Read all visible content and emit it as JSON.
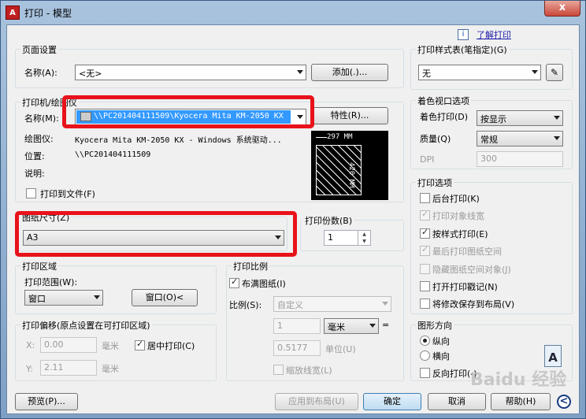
{
  "window": {
    "title": "打印 - 模型",
    "app_icon": "A",
    "close": "x"
  },
  "help": {
    "link": "了解打印"
  },
  "page_setup": {
    "group": "页面设置",
    "name_label": "名称(A):",
    "name_value": "<无>",
    "add_button": "添加(.)..."
  },
  "printer": {
    "group": "打印机/绘图仪",
    "name_label": "名称(M):",
    "name_value": "\\\\PC201404111509\\Kyocera Mita KM-2050 KX",
    "properties_button": "特性(R)...",
    "plotter_label": "绘图仪:",
    "plotter_value": "Kyocera Mita KM-2050 KX - Windows 系统驱动...",
    "location_label": "位置:",
    "location_value": "\\\\PC201404111509",
    "description_label": "说明:",
    "print_to_file": "打印到文件(F)",
    "preview_width": "297 MM",
    "preview_height": "420 MM"
  },
  "paper_size": {
    "group": "图纸尺寸(Z)",
    "value": "A3"
  },
  "copies": {
    "label": "打印份数(B)",
    "value": "1"
  },
  "plot_area": {
    "group": "打印区域",
    "range_label": "打印范围(W):",
    "range_value": "窗口",
    "window_button": "窗口(O)<"
  },
  "plot_offset": {
    "group": "打印偏移(原点设置在可打印区域)",
    "x_label": "X:",
    "x_value": "0.00",
    "x_unit": "毫米",
    "y_label": "Y:",
    "y_value": "2.11",
    "y_unit": "毫米",
    "center": "居中打印(C)"
  },
  "plot_scale": {
    "group": "打印比例",
    "fit": "布满图纸(I)",
    "scale_label": "比例(S):",
    "scale_value": "自定义",
    "value1": "1",
    "unit_value": "毫米",
    "eq": "=",
    "value2": "0.5177",
    "unit_label": "单位(U)",
    "scale_lineweights": "缩放线宽(L)"
  },
  "plot_style": {
    "group": "打印样式表(笔指定)(G)",
    "value": "无"
  },
  "shaded": {
    "group": "着色视口选项",
    "shade_label": "着色打印(D)",
    "shade_value": "按显示",
    "quality_label": "质量(Q)",
    "quality_value": "常规",
    "dpi_label": "DPI",
    "dpi_value": "300"
  },
  "plot_options": {
    "group": "打印选项",
    "items": [
      {
        "label": "后台打印(K)"
      },
      {
        "label": "打印对象线宽"
      },
      {
        "label": "按样式打印(E)"
      },
      {
        "label": "最后打印图纸空间"
      },
      {
        "label": "隐藏图纸空间对象(J)"
      },
      {
        "label": "打开打印戳记(N)"
      },
      {
        "label": "将修改保存到布局(V)"
      }
    ]
  },
  "orientation": {
    "group": "图形方向",
    "portrait": "纵向",
    "landscape": "横向",
    "reverse": "反向打印(-)",
    "icon": "A"
  },
  "buttons": {
    "preview": "预览(P)...",
    "apply": "应用到布局(U)",
    "ok": "确定",
    "cancel": "取消",
    "help": "帮助(H)",
    "more": "<"
  },
  "watermark": "Baidu 经验"
}
